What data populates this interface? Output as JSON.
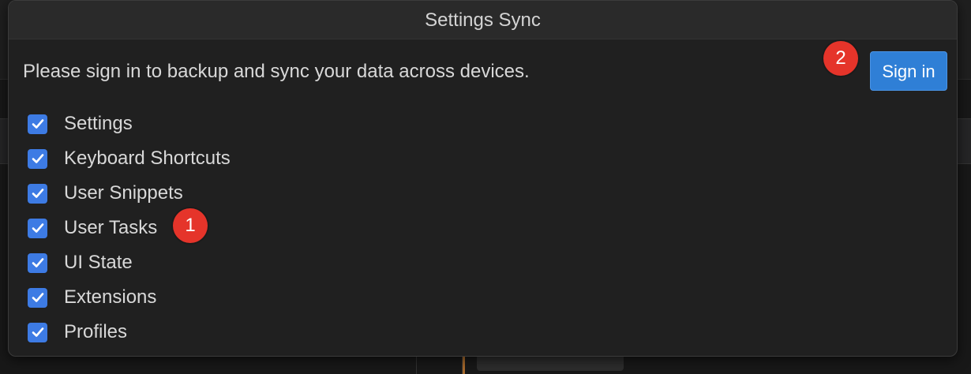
{
  "dialog": {
    "title": "Settings Sync",
    "message": "Please sign in to backup and sync your data across devices.",
    "signin_label": "Sign in"
  },
  "items": [
    {
      "label": "Settings",
      "checked": true
    },
    {
      "label": "Keyboard Shortcuts",
      "checked": true
    },
    {
      "label": "User Snippets",
      "checked": true
    },
    {
      "label": "User Tasks",
      "checked": true
    },
    {
      "label": "UI State",
      "checked": true
    },
    {
      "label": "Extensions",
      "checked": true
    },
    {
      "label": "Profiles",
      "checked": true
    }
  ],
  "annotations": {
    "badge1": "1",
    "badge2": "2"
  },
  "colors": {
    "accent": "#3d7be4",
    "button": "#2f7fd6",
    "badge": "#e5342a"
  }
}
